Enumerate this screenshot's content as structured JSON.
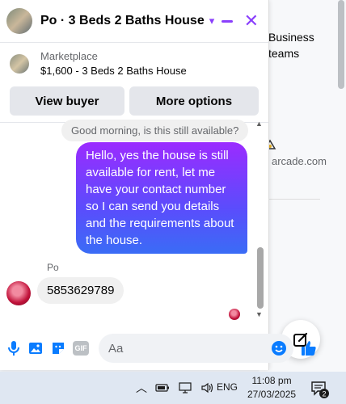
{
  "background": {
    "text_line1": "Business",
    "text_line2": "teams",
    "text_arcade": "arcade.com"
  },
  "chat": {
    "title": "Po · 3 Beds 2 Baths House",
    "marketplace_label": "Marketplace",
    "listing": "$1,600 - 3 Beds 2 Baths House",
    "view_buyer_label": "View buyer",
    "more_options_label": "More options",
    "messages": [
      {
        "direction": "in",
        "text": "Good morning, is this still available?"
      },
      {
        "direction": "out",
        "text": "Hello, yes the house is still available for rent, let me have your contact number so I can send you details and the requirements about the house."
      },
      {
        "direction": "in",
        "sender": "Po",
        "text": "5853629789"
      }
    ],
    "composer_placeholder": "Aa",
    "accent_color": "#8a3ffc",
    "bubble_gradient": [
      "#9b2bff",
      "#3a6cf6"
    ]
  },
  "taskbar": {
    "language": "ENG",
    "time": "11:08 pm",
    "date": "27/03/2025",
    "notification_count": "2"
  }
}
